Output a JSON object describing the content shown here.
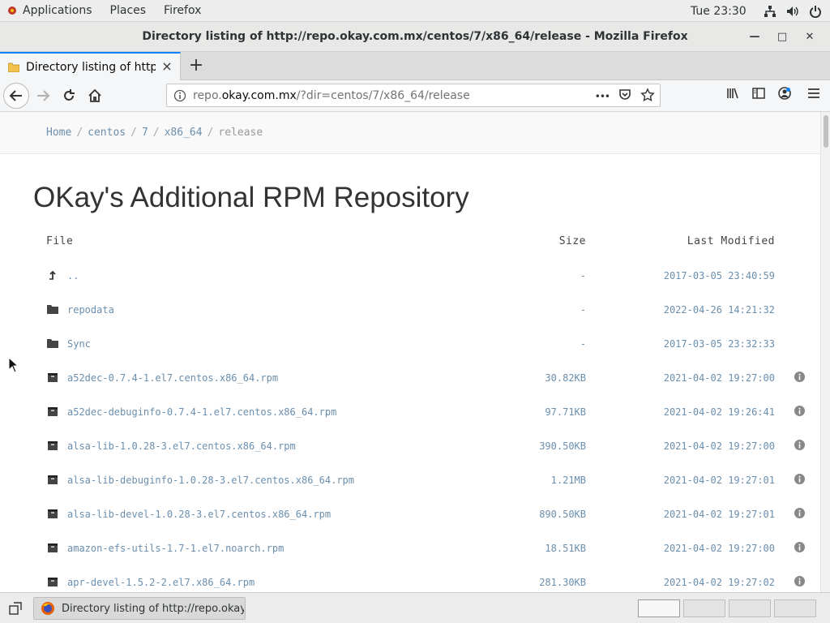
{
  "topbar": {
    "applications": "Applications",
    "places": "Places",
    "firefox": "Firefox",
    "clock": "Tue 23:30",
    "icons": [
      "network-icon",
      "volume-icon",
      "power-icon"
    ]
  },
  "window": {
    "title": "Directory listing of http://repo.okay.com.mx/centos/7/x86_64/release - Mozilla Firefox",
    "minimize": "—",
    "maximize": "□",
    "close": "✕"
  },
  "tab": {
    "label": "Directory listing of http://",
    "close": "×",
    "new_tab": "+"
  },
  "urlbar": {
    "prefix": "repo.",
    "domain": "okay.com.mx",
    "path": "/?dir=centos/7/x86_64/release",
    "more": "•••"
  },
  "breadcrumb": {
    "home": "Home",
    "items": [
      "centos",
      "7",
      "x86_64"
    ],
    "current": "release",
    "separator": "/"
  },
  "heading": "OKay's Additional RPM Repository",
  "listing": {
    "headers": {
      "file": "File",
      "size": "Size",
      "modified": "Last Modified"
    },
    "rows": [
      {
        "icon": "parent-dir-icon",
        "name": "..",
        "size": "-",
        "modified": "2017-03-05 23:40:59",
        "info": false
      },
      {
        "icon": "folder-icon",
        "name": "repodata",
        "size": "-",
        "modified": "2022-04-26 14:21:32",
        "info": false
      },
      {
        "icon": "folder-icon",
        "name": "Sync",
        "size": "-",
        "modified": "2017-03-05 23:32:33",
        "info": false
      },
      {
        "icon": "file-icon",
        "name": "a52dec-0.7.4-1.el7.centos.x86_64.rpm",
        "size": "30.82KB",
        "modified": "2021-04-02 19:27:00",
        "info": true
      },
      {
        "icon": "file-icon",
        "name": "a52dec-debuginfo-0.7.4-1.el7.centos.x86_64.rpm",
        "size": "97.71KB",
        "modified": "2021-04-02 19:26:41",
        "info": true
      },
      {
        "icon": "file-icon",
        "name": "alsa-lib-1.0.28-3.el7.centos.x86_64.rpm",
        "size": "390.50KB",
        "modified": "2021-04-02 19:27:00",
        "info": true
      },
      {
        "icon": "file-icon",
        "name": "alsa-lib-debuginfo-1.0.28-3.el7.centos.x86_64.rpm",
        "size": "1.21MB",
        "modified": "2021-04-02 19:27:01",
        "info": true
      },
      {
        "icon": "file-icon",
        "name": "alsa-lib-devel-1.0.28-3.el7.centos.x86_64.rpm",
        "size": "890.50KB",
        "modified": "2021-04-02 19:27:01",
        "info": true
      },
      {
        "icon": "file-icon",
        "name": "amazon-efs-utils-1.7-1.el7.noarch.rpm",
        "size": "18.51KB",
        "modified": "2021-04-02 19:27:00",
        "info": true
      },
      {
        "icon": "file-icon",
        "name": "apr-devel-1.5.2-2.el7.x86_64.rpm",
        "size": "281.30KB",
        "modified": "2021-04-02 19:27:02",
        "info": true
      }
    ]
  },
  "taskbar": {
    "task_label": "Directory listing of http://repo.okay....",
    "workspaces": 4
  },
  "colors": {
    "link": "#6b8fae",
    "accent": "#0a84ff"
  }
}
